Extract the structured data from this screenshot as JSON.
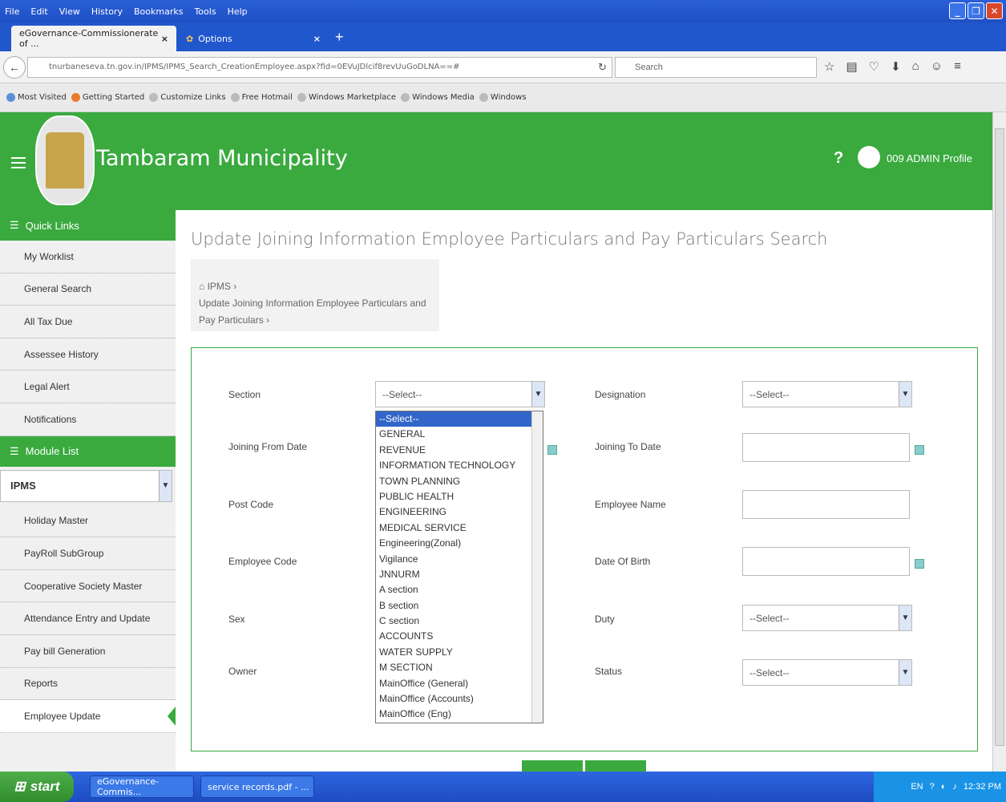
{
  "browser": {
    "menu": [
      "File",
      "Edit",
      "View",
      "History",
      "Bookmarks",
      "Tools",
      "Help"
    ],
    "tabs": [
      {
        "label": "eGovernance-Commissionerate of ..."
      },
      {
        "label": "Options"
      }
    ],
    "url": "tnurbaneseva.tn.gov.in/IPMS/IPMS_Search_CreationEmployee.aspx?fid=0EVuJDlcif8revUuGoDLNA==#",
    "search_placeholder": "Search",
    "bookmarks": [
      "Most Visited",
      "Getting Started",
      "Customize Links",
      "Free Hotmail",
      "Windows Marketplace",
      "Windows Media",
      "Windows"
    ]
  },
  "header": {
    "title": "Tambaram Municipality",
    "help": "?",
    "profile": "009 ADMIN Profile"
  },
  "sidebar": {
    "quick_links_label": "Quick Links",
    "quick_links": [
      "My Worklist",
      "General Search",
      "All Tax Due",
      "Assessee History",
      "Legal Alert",
      "Notifications"
    ],
    "module_list_label": "Module List",
    "module_selected": "IPMS",
    "modules": [
      "Holiday Master",
      "PayRoll SubGroup",
      "Cooperative Society Master",
      "Attendance Entry and Update",
      "Pay bill Generation",
      "Reports",
      "Employee Update"
    ]
  },
  "main": {
    "title": "Update Joining Information Employee Particulars and Pay Particulars Search",
    "breadcrumb_home": "IPMS",
    "breadcrumb_page": "Update Joining Information Employee Particulars and Pay Particulars"
  },
  "form": {
    "section_label": "Section",
    "section_value": "--Select--",
    "joining_from_label": "Joining From Date",
    "post_code_label": "Post Code",
    "employee_code_label": "Employee Code",
    "sex_label": "Sex",
    "owner_label": "Owner",
    "designation_label": "Designation",
    "designation_value": "--Select--",
    "joining_to_label": "Joining To Date",
    "employee_name_label": "Employee Name",
    "dob_label": "Date Of Birth",
    "duty_label": "Duty",
    "duty_value": "--Select--",
    "status_label": "Status",
    "status_value": "--Select--"
  },
  "section_options": [
    "--Select--",
    "GENERAL",
    "REVENUE",
    "INFORMATION TECHNOLOGY",
    "TOWN PLANNING",
    "PUBLIC HEALTH",
    "ENGINEERING",
    "MEDICAL SERVICE",
    "Engineering(Zonal)",
    "Vigilance",
    "JNNURM",
    "A section",
    "B section",
    "C section",
    "ACCOUNTS",
    "WATER SUPPLY",
    "M SECTION",
    "MainOffice (General)",
    "MainOffice (Accounts)",
    "MainOffice (Eng)"
  ],
  "taskbar": {
    "start": "start",
    "items": [
      "eGovernance-Commis...",
      "service records.pdf - ..."
    ],
    "lang": "EN",
    "time": "12:32 PM"
  }
}
